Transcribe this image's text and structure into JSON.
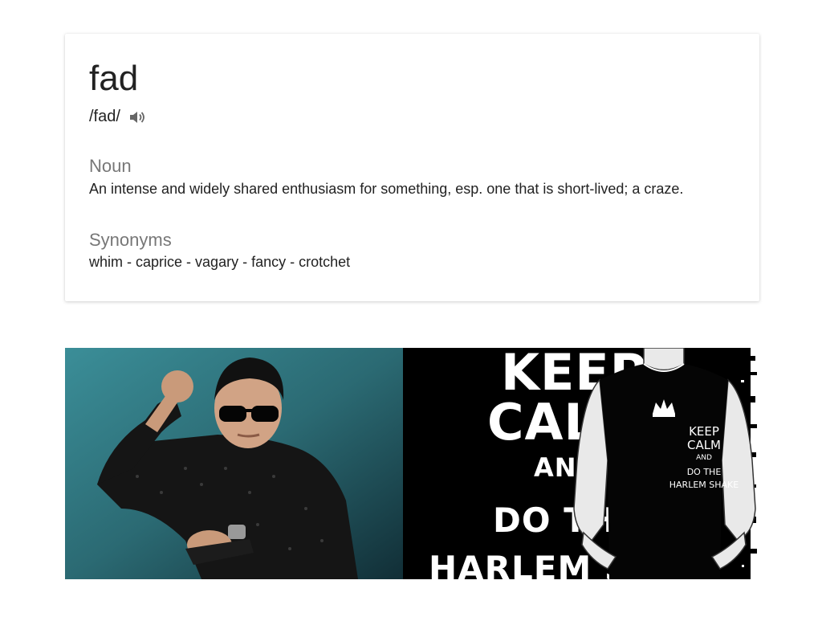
{
  "definition_card": {
    "word": "fad",
    "pronunciation": "/fad/",
    "speaker_icon": "speaker-icon",
    "part_of_speech": "Noun",
    "definition": "An intense and widely shared enthusiasm for something, esp. one that is short-lived; a craze.",
    "synonyms_label": "Synonyms",
    "synonyms": [
      "whim",
      "caprice",
      "vagary",
      "fancy",
      "crotchet"
    ]
  },
  "poster": {
    "line1": "KEEP",
    "line2": "CAL",
    "line3": "AN",
    "line4": "DO TH",
    "line5": "HARLEM S"
  },
  "shirt": {
    "line1": "KEEP",
    "line2": "CALM",
    "line3": "AND",
    "line4": "DO THE",
    "line5": "HARLEM SHAKE"
  }
}
